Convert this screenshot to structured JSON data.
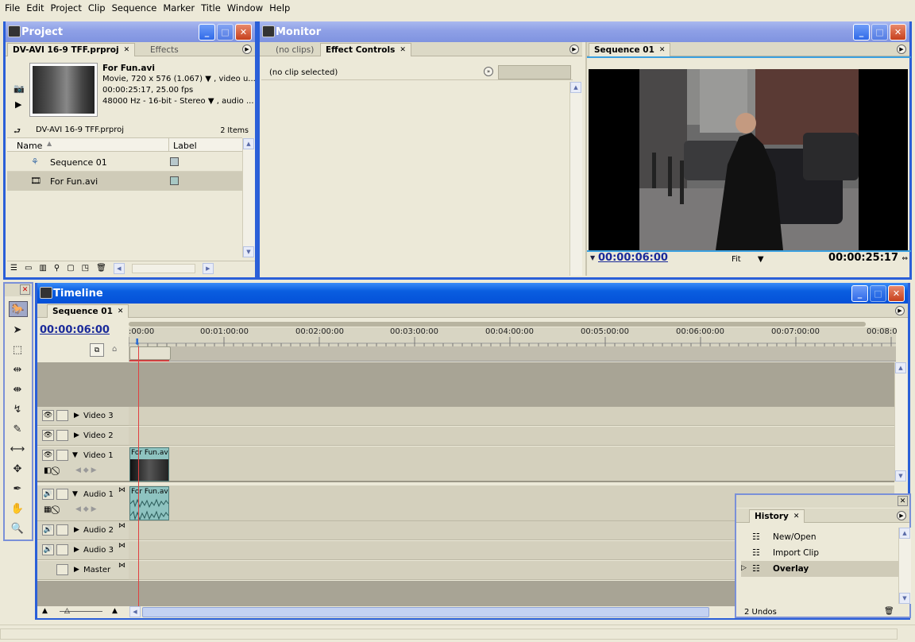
{
  "menu": [
    "File",
    "Edit",
    "Project",
    "Clip",
    "Sequence",
    "Marker",
    "Title",
    "Window",
    "Help"
  ],
  "project": {
    "title": "Project",
    "tabs": [
      {
        "label": "DV-AVI 16-9 TFF.prproj"
      },
      {
        "label": "Effects"
      }
    ],
    "clip_name": "For Fun.avi",
    "clip_info1": "Movie, 720 x 576 (1.067)",
    "clip_info1_extra": ", video u...",
    "clip_info2": "00:00:25:17, 25.00 fps",
    "clip_info3": "48000 Hz - 16-bit - Stereo",
    "clip_info3_extra": ", audio ...",
    "bin_name": "DV-AVI 16-9 TFF.prproj",
    "item_count": "2 Items",
    "col_name": "Name",
    "col_label": "Label",
    "items": [
      {
        "name": "Sequence 01",
        "label_color": "#b8c8cc"
      },
      {
        "name": "For Fun.avi",
        "label_color": "#a8c8c4"
      }
    ]
  },
  "monitor": {
    "title": "Monitor",
    "tabs": [
      {
        "label": "(no clips)"
      },
      {
        "label": "Effect Controls"
      }
    ],
    "no_clip": "(no clip selected)"
  },
  "program": {
    "tab": "Sequence 01",
    "timecode": "00:00:06:00",
    "zoom": "Fit",
    "duration": "00:00:25:17"
  },
  "timeline": {
    "title": "Timeline",
    "tab": "Sequence 01",
    "timecode": "00:00:06:00",
    "ticks": [
      ":00:00",
      "00:01:00:00",
      "00:02:00:00",
      "00:03:00:00",
      "00:04:00:00",
      "00:05:00:00",
      "00:06:00:00",
      "00:07:00:00",
      "00:08:0"
    ],
    "tracks": {
      "v3": "Video 3",
      "v2": "Video 2",
      "v1": "Video 1",
      "a1": "Audio 1",
      "a2": "Audio 2",
      "a3": "Audio 3",
      "master": "Master"
    },
    "clip_label": "For Fun.av"
  },
  "history": {
    "tab": "History",
    "items": [
      "New/Open",
      "Import Clip",
      "Overlay"
    ],
    "undos": "2 Undos"
  },
  "colors": {
    "titlebar_active": "#0a5ee0",
    "titlebar_inactive": "#8ea0e6",
    "clip": "#8ec3c0"
  }
}
